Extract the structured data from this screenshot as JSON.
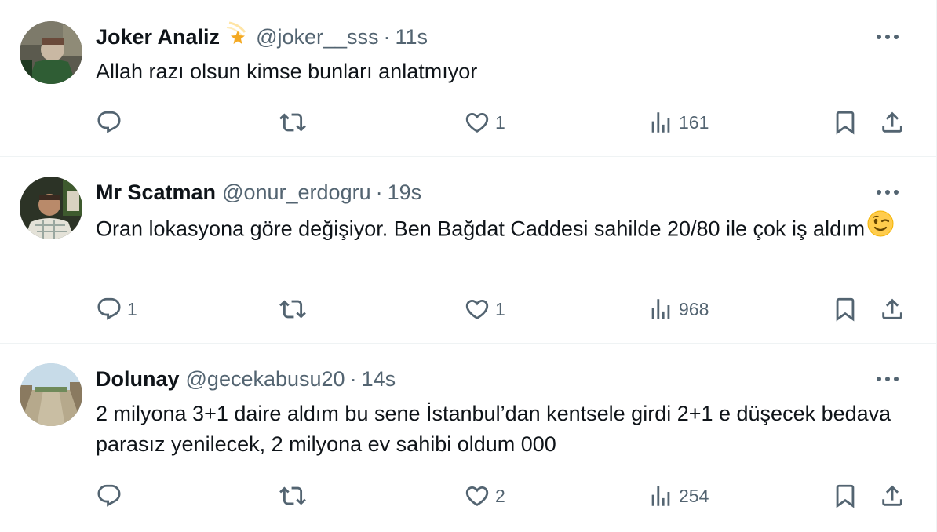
{
  "tweets": [
    {
      "display_name": "Joker Analiz",
      "badge_icon": "shooting-star-emoji",
      "handle": "@joker__sss",
      "separator": "·",
      "time": "11s",
      "text": "Allah razı olsun kimse bunları anlatmıyor",
      "replies": "",
      "retweets": "",
      "likes": "1",
      "views": "161"
    },
    {
      "display_name": "Mr Scatman",
      "handle": "@onur_erdogru",
      "separator": "·",
      "time": "19s",
      "text": "Oran lokasyona göre değişiyor. Ben Bağdat Caddesi sahilde 20/80 ile çok iş aldım",
      "text_emoji": "winking-face-emoji",
      "replies": "1",
      "retweets": "",
      "likes": "1",
      "views": "968"
    },
    {
      "display_name": "Dolunay",
      "handle": "@gecekabusu20",
      "separator": "·",
      "time": "14s",
      "text": "2 milyona 3+1 daire aldım bu sene İstanbul’dan kentsele girdi 2+1 e düşecek bedava parasız yenilecek, 2 milyona ev sahibi oldum 000",
      "replies": "",
      "retweets": "",
      "likes": "2",
      "views": "254"
    }
  ],
  "colors": {
    "text_primary": "#0f1419",
    "text_secondary": "#536471",
    "divider": "#eff3f4"
  },
  "icons": [
    "reply-icon",
    "retweet-icon",
    "like-icon",
    "views-icon",
    "bookmark-icon",
    "share-icon",
    "more-icon"
  ]
}
